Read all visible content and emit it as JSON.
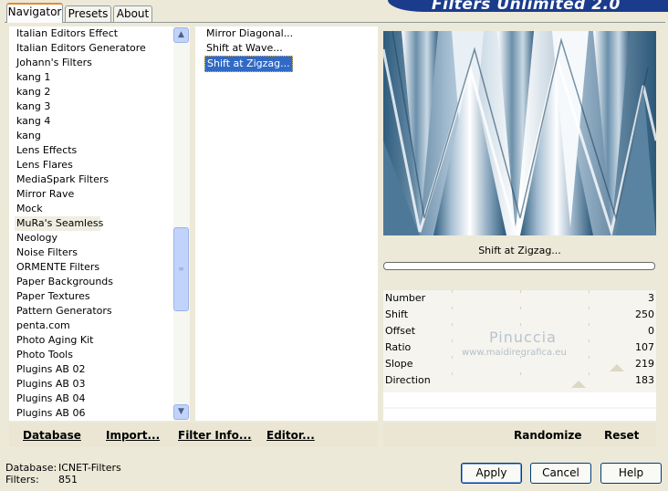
{
  "tabs": [
    "Navigator",
    "Presets",
    "About"
  ],
  "banner_title": "Filters Unlimited 2.0",
  "categories": [
    "Italian Editors Effect",
    "Italian Editors Generatore",
    "Johann's Filters",
    "kang 1",
    "kang 2",
    "kang 3",
    "kang 4",
    "kang",
    "Lens Effects",
    "Lens Flares",
    "MediaSpark Filters",
    "Mirror Rave",
    "Mock",
    "MuRa's Seamless",
    "Neology",
    "Noise Filters",
    "ORMENTE Filters",
    "Paper Backgrounds",
    "Paper Textures",
    "Pattern Generators",
    "penta.com",
    "Photo Aging Kit",
    "Photo Tools",
    "Plugins AB 02",
    "Plugins AB 03",
    "Plugins AB 04",
    "Plugins AB 06"
  ],
  "highlighted_category": "MuRa's Seamless",
  "filters": [
    "Mirror Diagonal...",
    "Shift at Wave...",
    "Shift at Zigzag..."
  ],
  "selected_filter": "Shift at Zigzag...",
  "preview_label": "Shift at Zigzag...",
  "params": [
    {
      "label": "Number",
      "value": "3"
    },
    {
      "label": "Shift",
      "value": "250"
    },
    {
      "label": "Offset",
      "value": "0"
    },
    {
      "label": "Ratio",
      "value": "107"
    },
    {
      "label": "Slope",
      "value": "219"
    },
    {
      "label": "Direction",
      "value": "183"
    }
  ],
  "watermark": {
    "name": "Pinuccia",
    "url": "www.maidiregrafica.eu"
  },
  "left_bar": {
    "database": "Database",
    "import": "Import...",
    "filter_info": "Filter Info...",
    "editor": "Editor..."
  },
  "right_bar": {
    "randomize": "Randomize",
    "reset": "Reset"
  },
  "status": {
    "database_label": "Database:",
    "database_value": "ICNET-Filters",
    "filters_label": "Filters:",
    "filters_value": "851"
  },
  "buttons": {
    "apply": "Apply",
    "cancel": "Cancel",
    "help": "Help"
  },
  "colors": {
    "selection": "#316ac5",
    "banner": "#1b3c8c",
    "tab_accent": "#e68b2c"
  }
}
